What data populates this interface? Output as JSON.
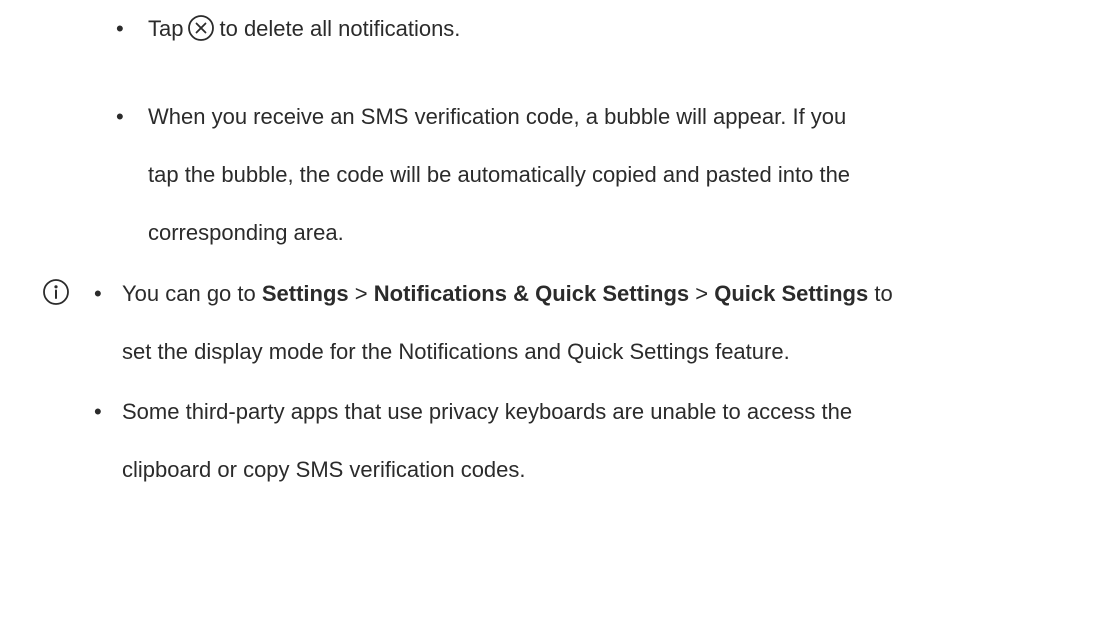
{
  "items": [
    {
      "tap_prefix": "Tap",
      "tap_suffix": "to delete all notifications.",
      "icon": "close-circle-icon"
    },
    {
      "line1": "When you receive an SMS verification code, a bubble will appear. If you",
      "line2": "tap the bubble, the code will be automatically copied and pasted into the",
      "line3": "corresponding area."
    }
  ],
  "notes": {
    "icon": "info-icon",
    "note1": {
      "prefix": "You can go to ",
      "settings": "Settings",
      "sep1": " > ",
      "notif_qs": "Notifications & Quick Settings",
      "sep2": " > ",
      "quick_settings": "Quick Settings",
      "suffix": " to",
      "line2": "set the display mode for the Notifications and Quick Settings feature."
    },
    "note2": {
      "line1": "Some third-party apps that use privacy keyboards are unable to access the",
      "line2": "clipboard or copy SMS verification codes."
    }
  },
  "bullet_char": "•"
}
